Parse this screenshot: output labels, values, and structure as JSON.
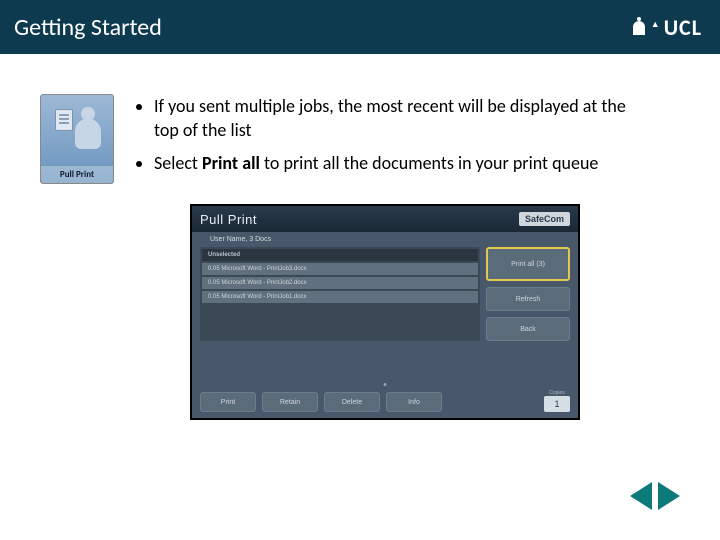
{
  "header": {
    "title": "Getting Started"
  },
  "logo": {
    "text": "UCL"
  },
  "tile": {
    "label": "Pull Print"
  },
  "bullets": [
    {
      "pre": "If you sent multiple jobs, the most recent will be displayed at the top of the list",
      "bold": "",
      "post": ""
    },
    {
      "pre": "Select ",
      "bold": "Print all",
      "post": " to print all the documents in your print queue"
    }
  ],
  "screenshot": {
    "title": "Pull Print",
    "brand": "SafeCom",
    "subline": "User Name, 3 Docs",
    "list_header": "Unselected",
    "jobs": [
      "0.05 Microsoft Word - PrintJob3.docx",
      "0.05 Microsoft Word - PrintJob2.docx",
      "0.05 Microsoft Word - PrintJob1.docx"
    ],
    "side_buttons": {
      "print_all": "Print all (3)",
      "refresh": "Refresh",
      "back": "Back"
    },
    "bottom_buttons": [
      "Print",
      "Retain",
      "Delete",
      "Info"
    ],
    "copies": {
      "label": "Copies",
      "value": "1"
    }
  }
}
